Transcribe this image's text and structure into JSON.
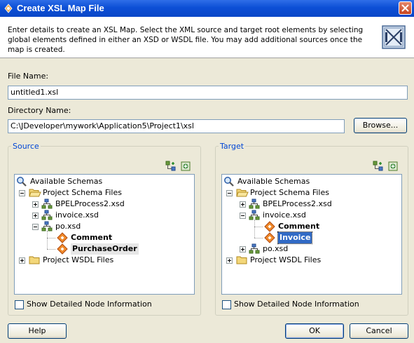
{
  "dialog": {
    "title": "Create XSL Map File",
    "description": "Enter details to create an XSL Map. Select the XML source and target root elements by selecting global elements defined in either an XSD or WSDL file.  You may add additional sources once the map is created."
  },
  "form": {
    "file_name_label": "File Name:",
    "file_name_value": "untitled1.xsl",
    "directory_label": "Directory Name:",
    "directory_value": "C:\\JDeveloper\\mywork\\Application5\\Project1\\xsl",
    "browse_label": "Browse..."
  },
  "source": {
    "group_label": "Source",
    "tree": {
      "root": "Available Schemas",
      "project_schema_files": "Project Schema Files",
      "bpel": "BPELProcess2.xsd",
      "invoice": "invoice.xsd",
      "po": "po.xsd",
      "comment": "Comment",
      "purchase_order": "PurchaseOrder",
      "wsdl": "Project WSDL Files"
    },
    "show_detailed_label": "Show Detailed Node Information"
  },
  "target": {
    "group_label": "Target",
    "tree": {
      "root": "Available Schemas",
      "project_schema_files": "Project Schema Files",
      "bpel": "BPELProcess2.xsd",
      "invoice": "invoice.xsd",
      "comment": "Comment",
      "invoice_el": "Invoice",
      "po": "po.xsd",
      "wsdl": "Project WSDL Files"
    },
    "show_detailed_label": "Show Detailed Node Information"
  },
  "footer": {
    "help_label": "Help",
    "ok_label": "OK",
    "cancel_label": "Cancel"
  }
}
